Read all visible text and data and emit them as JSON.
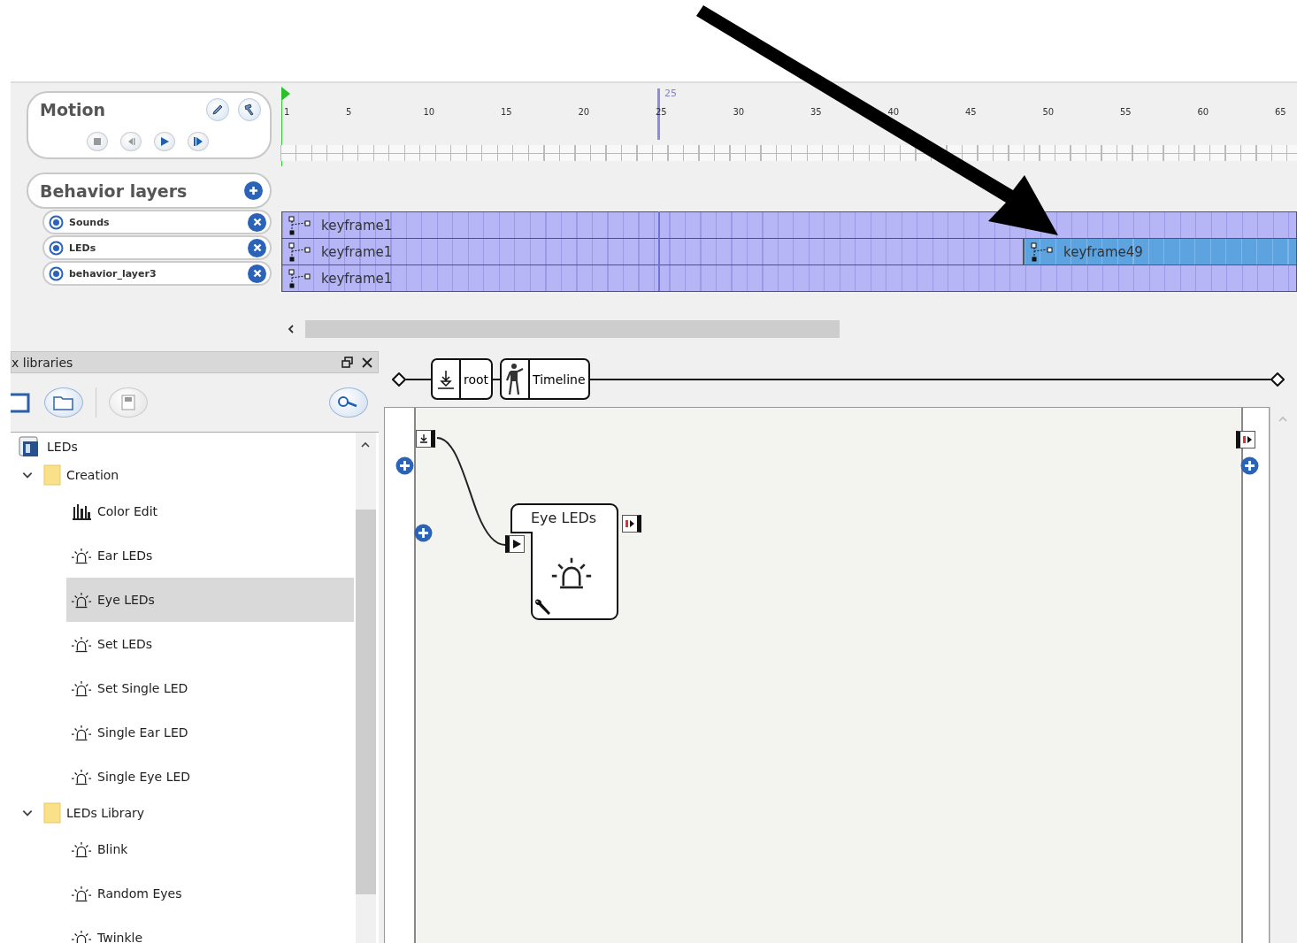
{
  "motion": {
    "title": "Motion"
  },
  "timeline": {
    "ruler_labels": [
      "1",
      "5",
      "10",
      "15",
      "20",
      "25",
      "30",
      "35",
      "40",
      "45",
      "50",
      "55",
      "60",
      "65"
    ],
    "playhead_label": "25"
  },
  "behavior_layers": {
    "title": "Behavior layers",
    "layers": [
      {
        "name": "Sounds",
        "keyframes": [
          {
            "label": "keyframe1",
            "selected": false
          }
        ]
      },
      {
        "name": "LEDs",
        "keyframes": [
          {
            "label": "keyframe1",
            "selected": false
          },
          {
            "label": "keyframe49",
            "selected": true
          }
        ]
      },
      {
        "name": "behavior_layer3",
        "keyframes": [
          {
            "label": "keyframe1",
            "selected": false
          }
        ]
      }
    ]
  },
  "box_libraries": {
    "title": "x libraries",
    "tree": [
      {
        "kind": "library",
        "label": "LEDs",
        "children": [
          {
            "kind": "folder",
            "label": "Creation",
            "expanded": true,
            "children": [
              {
                "kind": "color-box",
                "label": "Color Edit",
                "selected": false
              },
              {
                "kind": "led-box",
                "label": "Ear LEDs",
                "selected": false
              },
              {
                "kind": "led-box",
                "label": "Eye LEDs",
                "selected": true
              },
              {
                "kind": "led-box",
                "label": "Set LEDs",
                "selected": false
              },
              {
                "kind": "led-box",
                "label": "Set Single LED",
                "selected": false
              },
              {
                "kind": "led-box",
                "label": "Single Ear LED",
                "selected": false
              },
              {
                "kind": "led-box",
                "label": "Single Eye LED",
                "selected": false
              }
            ]
          },
          {
            "kind": "folder",
            "label": "LEDs Library",
            "expanded": true,
            "children": [
              {
                "kind": "led-box",
                "label": "Blink",
                "selected": false
              },
              {
                "kind": "led-box",
                "label": "Random Eyes",
                "selected": false
              },
              {
                "kind": "led-box",
                "label": "Twinkle",
                "selected": false
              }
            ]
          }
        ]
      }
    ]
  },
  "breadcrumb": [
    {
      "kind": "root",
      "label": "root"
    },
    {
      "kind": "timeline",
      "label": "Timeline"
    }
  ],
  "flow_diagram": {
    "boxes": [
      {
        "title": "Eye LEDs"
      }
    ]
  }
}
